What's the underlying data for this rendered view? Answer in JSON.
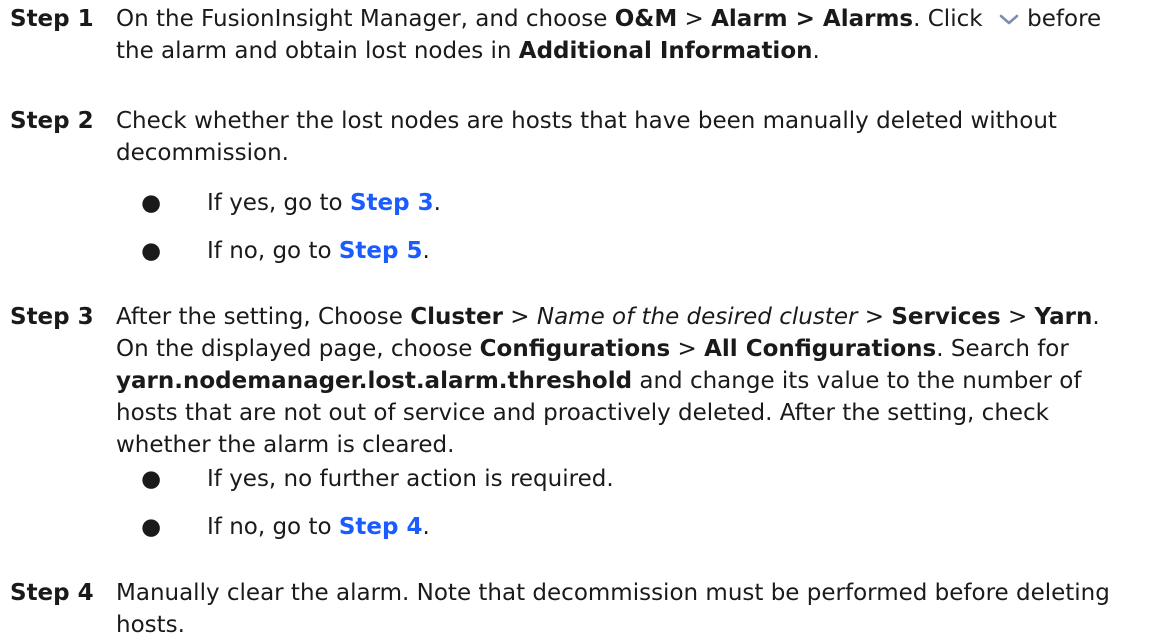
{
  "steps": [
    {
      "label": "Step 1",
      "parts": [
        {
          "t": "On the FusionInsight Manager, and choose "
        },
        {
          "t": "O&M",
          "b": true
        },
        {
          "t": " > "
        },
        {
          "t": "Alarm > Alarms",
          "b": true
        },
        {
          "t": ". Click "
        },
        {
          "icon": "chevron-down-icon"
        },
        {
          "t": " before the alarm and obtain lost nodes in "
        },
        {
          "t": "Additional Information",
          "b": true
        },
        {
          "t": "."
        }
      ]
    },
    {
      "label": "Step 2",
      "parts": [
        {
          "t": "Check whether the lost nodes are hosts that have been manually deleted without decommission."
        }
      ],
      "bullets": [
        {
          "parts": [
            {
              "t": "If yes, go to "
            },
            {
              "t": "Step 3",
              "link": true
            },
            {
              "t": "."
            }
          ]
        },
        {
          "parts": [
            {
              "t": "If no, go to "
            },
            {
              "t": "Step 5",
              "link": true
            },
            {
              "t": "."
            }
          ]
        }
      ]
    },
    {
      "label": "Step 3",
      "parts": [
        {
          "t": "After the setting, Choose "
        },
        {
          "t": "Cluster",
          "b": true
        },
        {
          "t": " > "
        },
        {
          "t": "Name of the desired cluster",
          "i": true
        },
        {
          "t": " > "
        },
        {
          "t": "Services",
          "b": true
        },
        {
          "t": " > "
        },
        {
          "t": "Yarn",
          "b": true
        },
        {
          "t": ". On the displayed page, choose "
        },
        {
          "t": "Configurations",
          "b": true
        },
        {
          "t": " > "
        },
        {
          "t": "All Configurations",
          "b": true
        },
        {
          "t": ". Search for "
        },
        {
          "t": "yarn.nodemanager.lost.alarm.threshold",
          "b": true
        },
        {
          "t": " and change its value to the number of hosts that are not out of service and proactively deleted. After the setting, check whether the alarm is cleared."
        }
      ],
      "bullets": [
        {
          "parts": [
            {
              "t": "If yes, no further action is required."
            }
          ]
        },
        {
          "parts": [
            {
              "t": "If no, go to "
            },
            {
              "t": "Step 4",
              "link": true
            },
            {
              "t": "."
            }
          ]
        }
      ]
    },
    {
      "label": "Step 4",
      "parts": [
        {
          "t": "Manually clear the alarm. Note that decommission must be performed before deleting hosts."
        }
      ]
    }
  ],
  "bullet_glyph": "●"
}
